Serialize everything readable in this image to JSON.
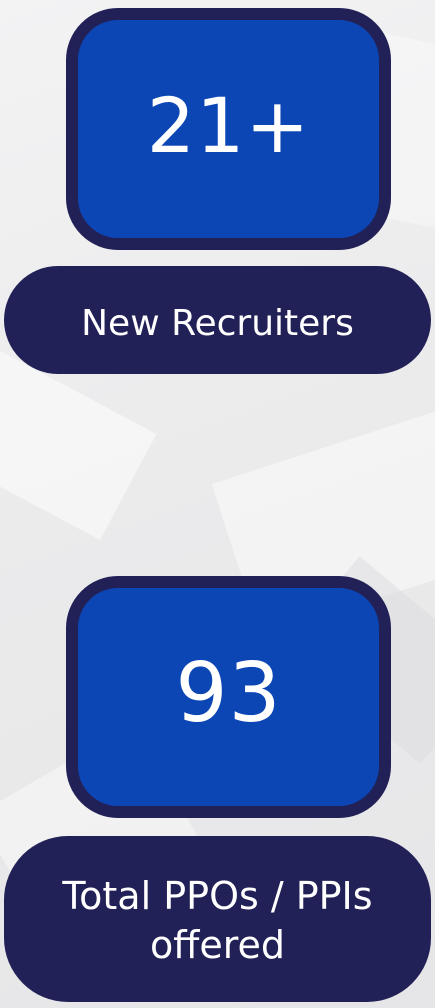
{
  "stats": [
    {
      "value": "21+",
      "label": "New Recruiters"
    },
    {
      "value": "93",
      "label": "Total PPOs / PPIs offered"
    }
  ],
  "colors": {
    "box_fill": "#0b46b4",
    "box_border": "#222157",
    "pill_fill": "#222157",
    "text": "#ffffff",
    "background": "#ececed"
  }
}
